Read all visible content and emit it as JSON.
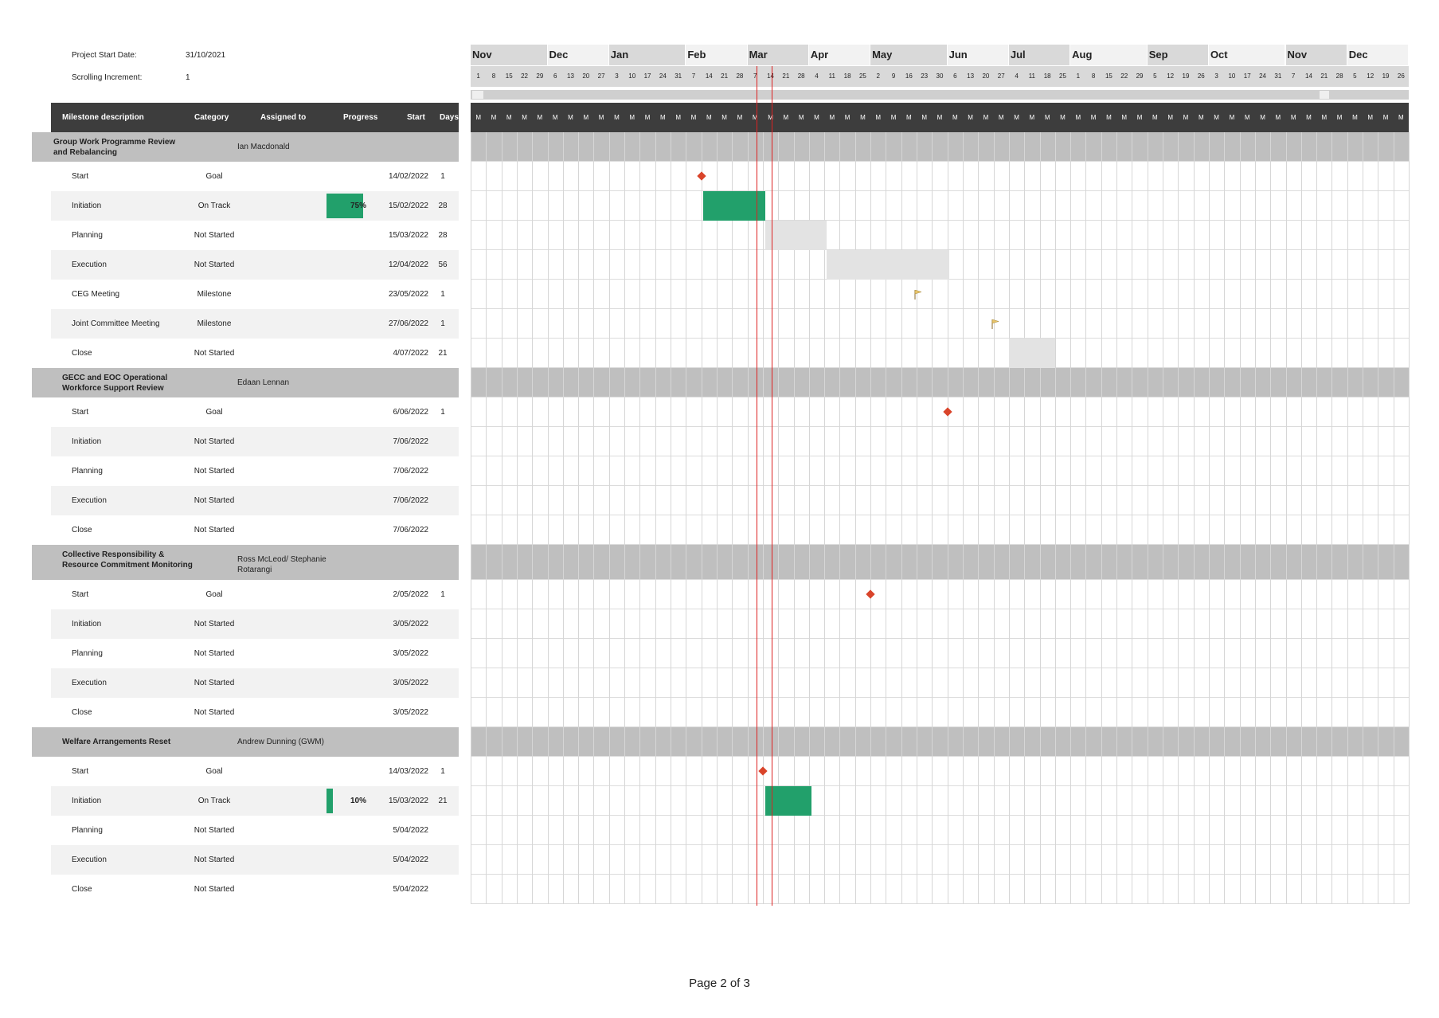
{
  "project_start": {
    "label": "Project Start Date:",
    "value": "31/10/2021"
  },
  "scrolling": {
    "label": "Scrolling Increment:",
    "value": "1"
  },
  "headers": {
    "description": "Milestone description",
    "category": "Category",
    "assigned": "Assigned to",
    "progress": "Progress",
    "start": "Start",
    "days": "Days"
  },
  "months": [
    "Nov",
    "Dec",
    "Jan",
    "Feb",
    "Mar",
    "Apr",
    "May",
    "Jun",
    "Jul",
    "Aug",
    "Sep",
    "Oct",
    "Nov",
    "Dec"
  ],
  "weeks": [
    "1",
    "8",
    "15",
    "22",
    "29",
    "6",
    "13",
    "20",
    "27",
    "3",
    "10",
    "17",
    "24",
    "31",
    "7",
    "14",
    "21",
    "28",
    "7",
    "14",
    "21",
    "28",
    "4",
    "11",
    "18",
    "25",
    "2",
    "9",
    "16",
    "23",
    "30",
    "6",
    "13",
    "20",
    "27",
    "4",
    "11",
    "18",
    "25",
    "1",
    "8",
    "15",
    "22",
    "29",
    "5",
    "12",
    "19",
    "26",
    "3",
    "10",
    "17",
    "24",
    "31",
    "7",
    "14",
    "21",
    "28",
    "5",
    "12",
    "19",
    "26"
  ],
  "week_day_label": "M",
  "groups": [
    {
      "title": "Group Work Programme Review and Rebalancing",
      "assigned": "Ian Macdonald",
      "rows": [
        {
          "name": "Start",
          "category": "Goal",
          "progress": "",
          "start": "14/02/2022",
          "days": "1"
        },
        {
          "name": "Initiation",
          "category": "On Track",
          "progress": "75%",
          "start": "15/02/2022",
          "days": "28"
        },
        {
          "name": "Planning",
          "category": "Not Started",
          "progress": "",
          "start": "15/03/2022",
          "days": "28"
        },
        {
          "name": "Execution",
          "category": "Not Started",
          "progress": "",
          "start": "12/04/2022",
          "days": "56"
        },
        {
          "name": "CEG Meeting",
          "category": "Milestone",
          "progress": "",
          "start": "23/05/2022",
          "days": "1"
        },
        {
          "name": "Joint Committee Meeting",
          "category": "Milestone",
          "progress": "",
          "start": "27/06/2022",
          "days": "1"
        },
        {
          "name": "Close",
          "category": "Not Started",
          "progress": "",
          "start": "4/07/2022",
          "days": "21"
        }
      ]
    },
    {
      "title": "GECC and EOC Operational Workforce Support Review",
      "assigned": "Edaan Lennan",
      "rows": [
        {
          "name": "Start",
          "category": "Goal",
          "progress": "",
          "start": "6/06/2022",
          "days": "1"
        },
        {
          "name": "Initiation",
          "category": "Not Started",
          "progress": "",
          "start": "7/06/2022",
          "days": ""
        },
        {
          "name": "Planning",
          "category": "Not Started",
          "progress": "",
          "start": "7/06/2022",
          "days": ""
        },
        {
          "name": "Execution",
          "category": "Not Started",
          "progress": "",
          "start": "7/06/2022",
          "days": ""
        },
        {
          "name": "Close",
          "category": "Not Started",
          "progress": "",
          "start": "7/06/2022",
          "days": ""
        }
      ]
    },
    {
      "title": "Collective Responsibility & Resource Commitment Monitoring",
      "assigned": "Ross McLeod/ Stephanie Rotarangi",
      "rows": [
        {
          "name": "Start",
          "category": "Goal",
          "progress": "",
          "start": "2/05/2022",
          "days": "1"
        },
        {
          "name": "Initiation",
          "category": "Not Started",
          "progress": "",
          "start": "3/05/2022",
          "days": ""
        },
        {
          "name": "Planning",
          "category": "Not Started",
          "progress": "",
          "start": "3/05/2022",
          "days": ""
        },
        {
          "name": "Execution",
          "category": "Not Started",
          "progress": "",
          "start": "3/05/2022",
          "days": ""
        },
        {
          "name": "Close",
          "category": "Not Started",
          "progress": "",
          "start": "3/05/2022",
          "days": ""
        }
      ]
    },
    {
      "title": "Welfare Arrangements Reset",
      "assigned": "Andrew Dunning (GWM)",
      "rows": [
        {
          "name": "Start",
          "category": "Goal",
          "progress": "",
          "start": "14/03/2022",
          "days": "1"
        },
        {
          "name": "Initiation",
          "category": "On Track",
          "progress": "10%",
          "start": "15/03/2022",
          "days": "21"
        },
        {
          "name": "Planning",
          "category": "Not Started",
          "progress": "",
          "start": "5/04/2022",
          "days": ""
        },
        {
          "name": "Execution",
          "category": "Not Started",
          "progress": "",
          "start": "5/04/2022",
          "days": ""
        },
        {
          "name": "Close",
          "category": "Not Started",
          "progress": "",
          "start": "5/04/2022",
          "days": ""
        }
      ]
    }
  ],
  "footer": {
    "page": "Page 2 of 3"
  },
  "colors": {
    "header": "#3d3d3d",
    "group": "#bfbfbf",
    "on_track": "#22a06b",
    "not_started": "#e3e3e3",
    "goal": "#d9442a",
    "today_line": "#dd2222"
  }
}
